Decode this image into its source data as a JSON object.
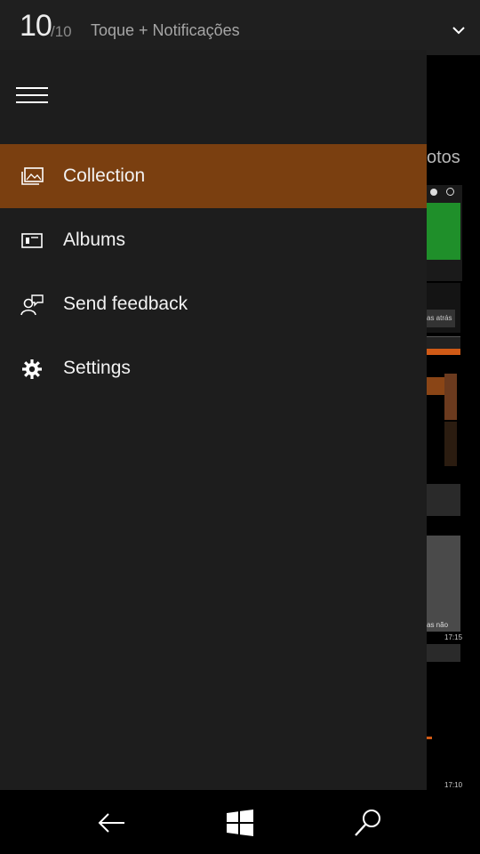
{
  "status": {
    "current": "10",
    "total": "/10",
    "title": "Toque + Notificações",
    "expand_icon": "chevron-down-icon"
  },
  "background_app": {
    "title_fragment": "otos",
    "snippets": [
      "as atrás",
      "as não",
      "17:15",
      "17:10"
    ]
  },
  "drawer": {
    "menu_icon": "hamburger-icon",
    "items": [
      {
        "label": "Collection",
        "icon": "collection-icon",
        "selected": true
      },
      {
        "label": "Albums",
        "icon": "album-icon",
        "selected": false
      },
      {
        "label": "Send feedback",
        "icon": "feedback-icon",
        "selected": false
      },
      {
        "label": "Settings",
        "icon": "gear-icon",
        "selected": false
      }
    ]
  },
  "navbar": {
    "back_icon": "back-arrow-icon",
    "start_icon": "windows-logo-icon",
    "search_icon": "search-icon"
  },
  "colors": {
    "accent": "#7a3f10",
    "drawer_bg": "#1d1d1d",
    "status_bg": "#1f1f1f",
    "navbar_bg": "#000000"
  }
}
